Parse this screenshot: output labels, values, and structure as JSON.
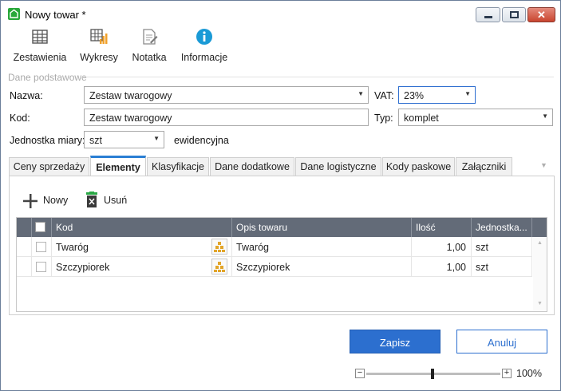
{
  "window": {
    "title": "Nowy towar *"
  },
  "toolbar": {
    "items": [
      {
        "label": "Zestawienia",
        "icon": "table-icon"
      },
      {
        "label": "Wykresy",
        "icon": "chart-icon"
      },
      {
        "label": "Notatka",
        "icon": "note-icon"
      },
      {
        "label": "Informacje",
        "icon": "info-icon"
      }
    ]
  },
  "section": {
    "title": "Dane podstawowe"
  },
  "form": {
    "nazwa_label": "Nazwa:",
    "nazwa_value": "Zestaw twarogowy",
    "vat_label": "VAT:",
    "vat_value": "23%",
    "kod_label": "Kod:",
    "kod_value": "Zestaw twarogowy",
    "typ_label": "Typ:",
    "typ_value": "komplet",
    "jm_label": "Jednostka miary:",
    "jm_value": "szt",
    "jm_note": "ewidencyjna"
  },
  "tabs": [
    {
      "label": "Ceny sprzedaży",
      "active": false
    },
    {
      "label": "Elementy",
      "active": true
    },
    {
      "label": "Klasyfikacje",
      "active": false
    },
    {
      "label": "Dane dodatkowe",
      "active": false
    },
    {
      "label": "Dane logistyczne",
      "active": false
    },
    {
      "label": "Kody paskowe",
      "active": false
    },
    {
      "label": "Załączniki",
      "active": false
    }
  ],
  "panel": {
    "new_label": "Nowy",
    "delete_label": "Usuń"
  },
  "grid": {
    "columns": [
      "Kod",
      "Opis towaru",
      "Ilość",
      "Jednostka..."
    ],
    "rows": [
      {
        "kod": "Twaróg",
        "opis": "Twaróg",
        "ilosc": "1,00",
        "jednostka": "szt"
      },
      {
        "kod": "Szczypiorek",
        "opis": "Szczypiorek",
        "ilosc": "1,00",
        "jednostka": "szt"
      }
    ]
  },
  "buttons": {
    "save": "Zapisz",
    "cancel": "Anuluj"
  },
  "zoom": {
    "label": "100%",
    "minus": "−",
    "plus": "+"
  },
  "colors": {
    "accent": "#2c6fcf",
    "tab_indicator": "#2a7fd4",
    "grid_header": "#636b78"
  }
}
